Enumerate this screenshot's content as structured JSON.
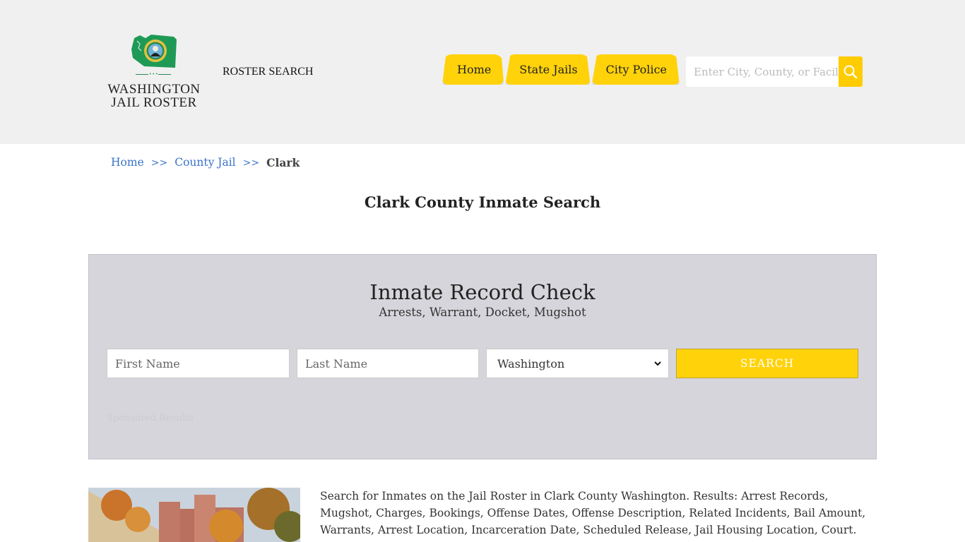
{
  "header": {
    "logo": {
      "line1": "WASHINGTON",
      "line2": "JAIL ROSTER",
      "dots": "•••",
      "icon": "washington-state-seal-map-icon"
    },
    "roster_search_label": "ROSTER SEARCH",
    "nav": [
      {
        "label": "Home"
      },
      {
        "label": "State Jails"
      },
      {
        "label": "City Police"
      }
    ],
    "search": {
      "placeholder": "Enter City, County, or Facility",
      "icon": "search-icon"
    },
    "colors": {
      "accent": "#ffd20a",
      "background": "#f0f0f0"
    }
  },
  "breadcrumb": {
    "items": [
      {
        "label": "Home"
      },
      {
        "label": "County Jail"
      }
    ],
    "separator": ">>",
    "current": "Clark"
  },
  "page_title": "Clark County Inmate Search",
  "record_check": {
    "title": "Inmate Record Check",
    "subtitle": "Arrests, Warrant, Docket, Mugshot",
    "first_name_placeholder": "First Name",
    "last_name_placeholder": "Last Name",
    "state_selected": "Washington",
    "search_label": "SEARCH",
    "sponsored_label": "Sponsored Results"
  },
  "content": {
    "image_alt": "Clark County jail building with autumn trees",
    "description": "Search for Inmates on the Jail Roster in Clark County Washington. Results: Arrest Records, Mugshot, Charges, Bookings, Offense Dates, Offense Description, Related Incidents, Bail Amount, Warrants, Arrest Location, Incarceration Date, Scheduled Release, Jail Housing Location, Court."
  }
}
